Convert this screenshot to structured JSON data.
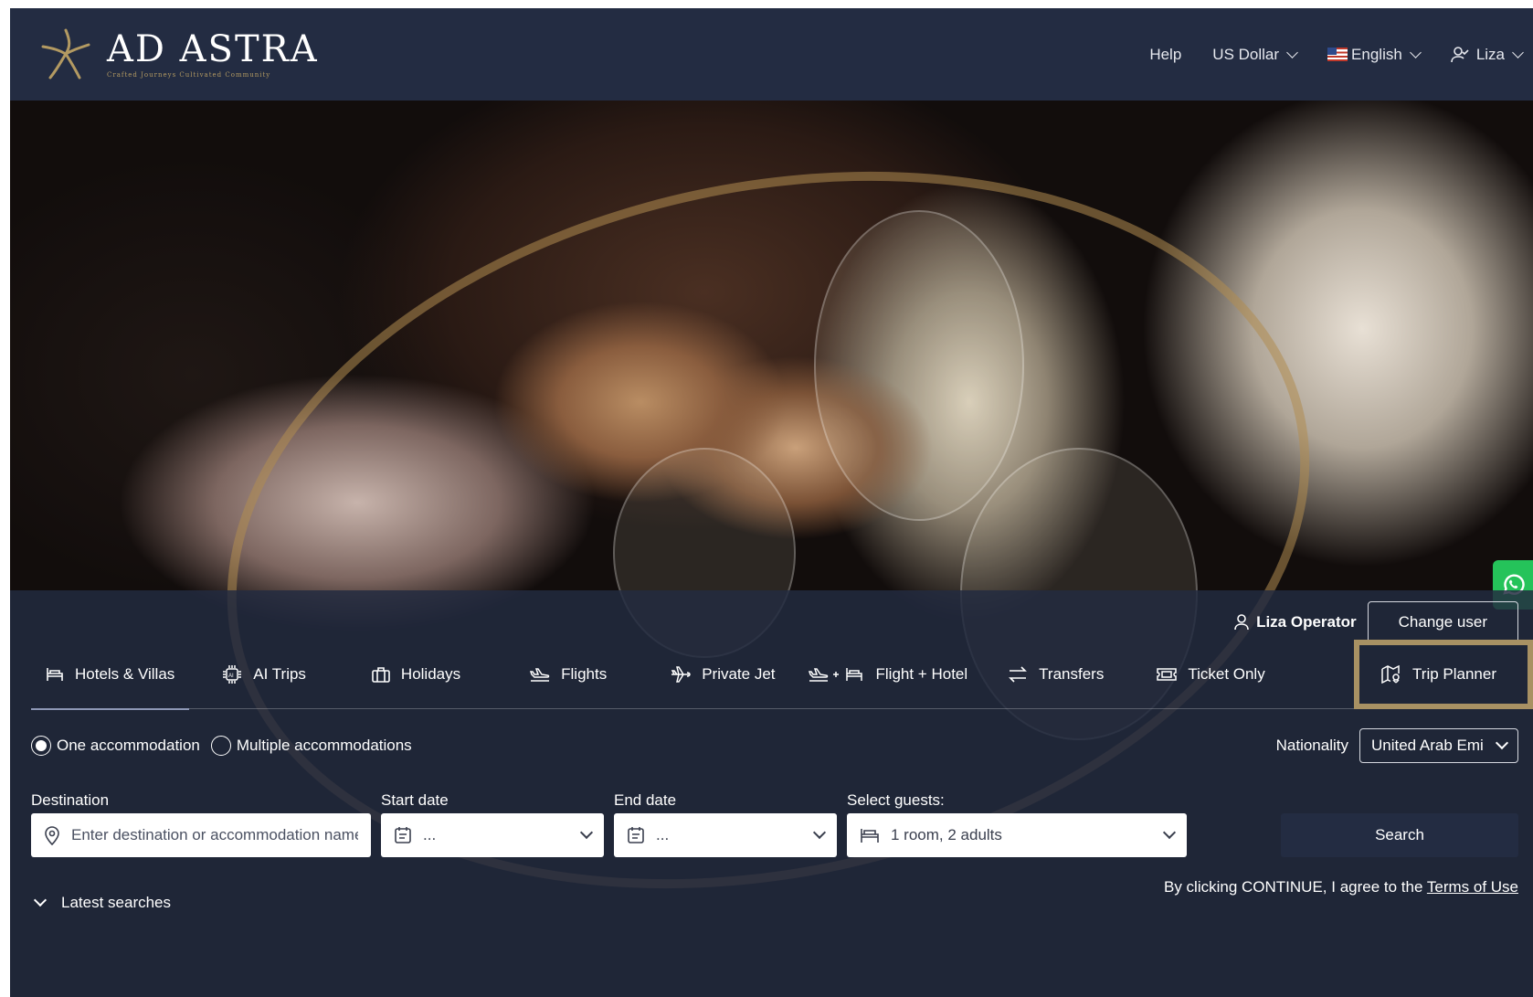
{
  "brand": {
    "name": "AD ASTRA",
    "tagline": "Crafted Journeys Cultivated Community",
    "gold": "#b39a62"
  },
  "topnav": {
    "help": "Help",
    "currency": "US Dollar",
    "language": "English",
    "user": "Liza"
  },
  "panel": {
    "operator_name": "Liza Operator",
    "change_user": "Change user",
    "tabs": [
      {
        "label": "Hotels & Villas",
        "icon": "bed-icon",
        "active": true
      },
      {
        "label": "AI Trips",
        "icon": "ai-chip-icon"
      },
      {
        "label": "Holidays",
        "icon": "suitcase-icon"
      },
      {
        "label": "Flights",
        "icon": "plane-icon"
      },
      {
        "label": "Private Jet",
        "icon": "jet-icon"
      },
      {
        "label": "Flight + Hotel",
        "icon": "plane-bed-icon"
      },
      {
        "label": "Transfers",
        "icon": "transfer-arrows-icon"
      },
      {
        "label": "Ticket Only",
        "icon": "ticket-icon"
      },
      {
        "label": "Trip Planner",
        "icon": "map-pin-icon",
        "highlighted": true
      }
    ],
    "radio_one": "One accommodation",
    "radio_multiple": "Multiple accommodations",
    "nationality_label": "Nationality",
    "nationality_value": "United Arab Emirates",
    "destination_label": "Destination",
    "destination_placeholder": "Enter destination or accommodation name",
    "start_label": "Start date",
    "start_value": "...",
    "end_label": "End date",
    "end_value": "...",
    "guests_label": "Select guests:",
    "guests_value": "1 room, 2 adults",
    "search": "Search",
    "terms_prefix": "By clicking CONTINUE, I agree to the ",
    "terms_link": "Terms of Use",
    "latest_searches": "Latest searches"
  },
  "colors": {
    "header_bg": "#232c42",
    "highlight_border": "#a89163",
    "whatsapp": "#25c35a"
  }
}
